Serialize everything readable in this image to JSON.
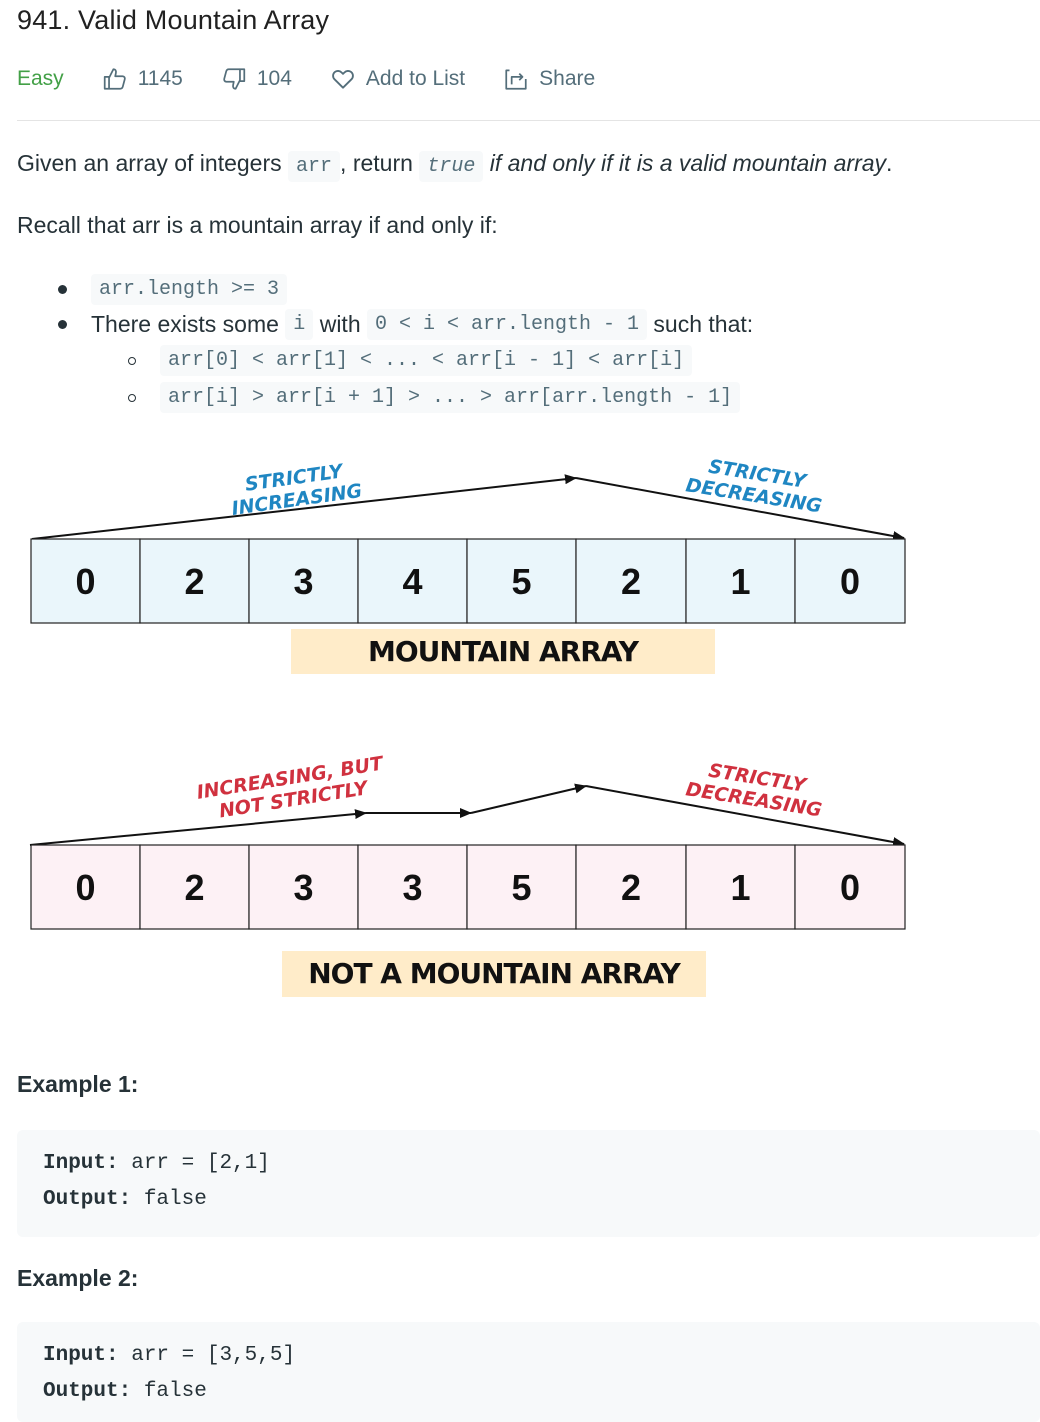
{
  "problem": {
    "title": "941. Valid Mountain Array",
    "difficulty": "Easy",
    "likes": "1145",
    "dislikes": "104",
    "add_to_list": "Add to List",
    "share": "Share"
  },
  "colors": {
    "easy": "#43a047",
    "meta_text": "#546e7a",
    "code_bg": "#f7f9fa",
    "blue_label": "#1f86c2",
    "red_label": "#d0313f",
    "mountain_cell_fill": "#eaf6fb",
    "not_mountain_cell_fill": "#fdf1f5",
    "caption_fill": "#ffecc9"
  },
  "description": {
    "p1_prefix": "Given an array of integers ",
    "p1_code1": "arr",
    "p1_mid": ", return ",
    "p1_code2": "true",
    "p1_italic": " if and only if it is a valid mountain array",
    "p1_end": ".",
    "p2": "Recall that arr is a mountain array if and only if:",
    "bullet1_code": "arr.length >= 3",
    "bullet2_prefix": "There exists some ",
    "bullet2_code1": "i",
    "bullet2_mid": " with ",
    "bullet2_code2": "0 < i < arr.length - 1",
    "bullet2_suffix": " such that:",
    "sub1_code": "arr[0] < arr[1] < ... < arr[i - 1] < arr[i]",
    "sub2_code": "arr[i] > arr[i + 1] > ... > arr[arr.length - 1]"
  },
  "diagram": {
    "mountain": {
      "values": [
        "0",
        "2",
        "3",
        "4",
        "5",
        "2",
        "1",
        "0"
      ],
      "label_up_1": "STRICTLY",
      "label_up_2": "INCREASING",
      "label_down_1": "STRICTLY",
      "label_down_2": "DECREASING",
      "caption": "MOUNTAIN ARRAY"
    },
    "not_mountain": {
      "values": [
        "0",
        "2",
        "3",
        "3",
        "5",
        "2",
        "1",
        "0"
      ],
      "label_up_1": "INCREASING, BUT",
      "label_up_2": "NOT STRICTLY",
      "label_down_1": "STRICTLY",
      "label_down_2": "DECREASING",
      "caption": "NOT A MOUNTAIN ARRAY"
    }
  },
  "examples": [
    {
      "title": "Example 1:",
      "input_label": "Input:",
      "input": " arr = [2,1]",
      "output_label": "Output:",
      "output": " false"
    },
    {
      "title": "Example 2:",
      "input_label": "Input:",
      "input": " arr = [3,5,5]",
      "output_label": "Output:",
      "output": " false"
    }
  ]
}
